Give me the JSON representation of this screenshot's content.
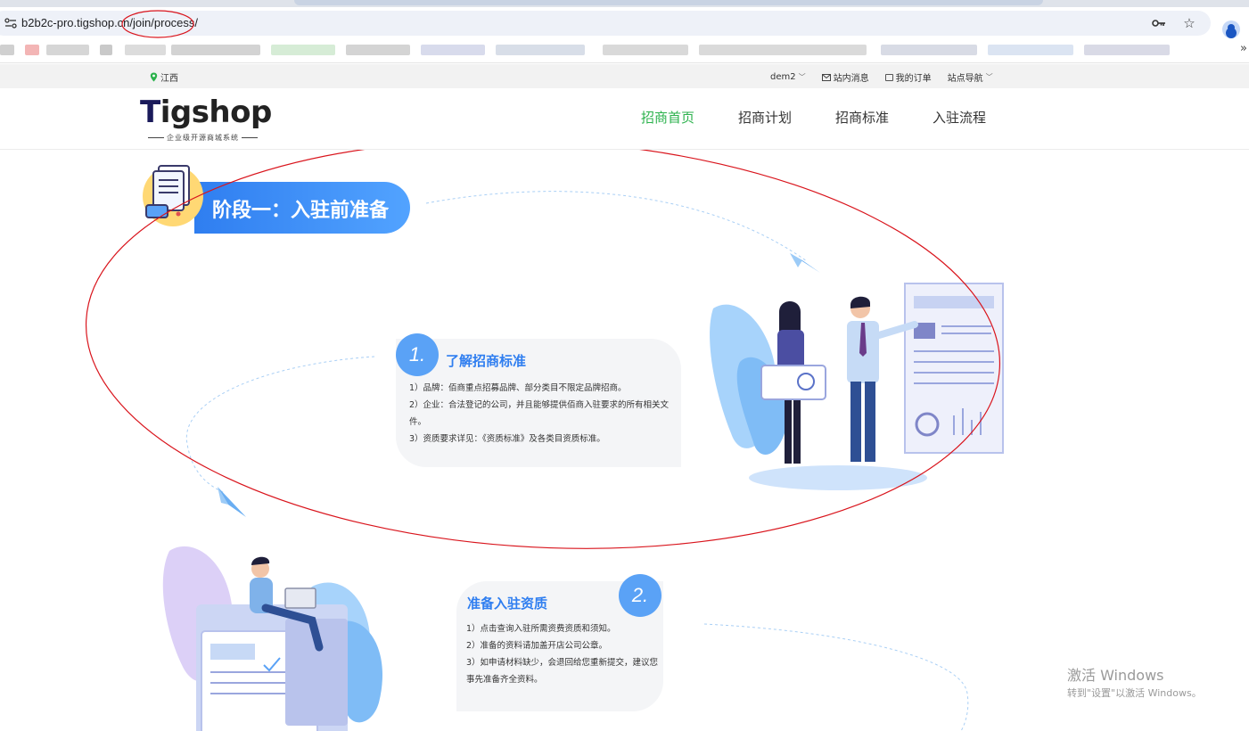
{
  "browser": {
    "url_host": "b2b2c-pro.tigshop.cn",
    "url_path": "/join/process/",
    "icons": [
      "site-info-icon",
      "key-icon",
      "star-icon",
      "profile-icon"
    ],
    "bookmarks_overflow": "»"
  },
  "topbar": {
    "location": "江西",
    "user": "dem2",
    "messages": "站内消息",
    "orders": "我的订单",
    "site_nav": "站点导航"
  },
  "header": {
    "logo_text_t": "T",
    "logo_text_rest": "igshop",
    "logo_subtitle": "企业级开源商城系统",
    "nav": [
      {
        "label": "招商首页",
        "active": true
      },
      {
        "label": "招商计划",
        "active": false
      },
      {
        "label": "招商标准",
        "active": false
      },
      {
        "label": "入驻流程",
        "active": false
      }
    ]
  },
  "stage": {
    "title": "阶段一：入驻前准备"
  },
  "steps": [
    {
      "number": "1.",
      "title": "了解招商标准",
      "lines": [
        "1）品牌：佰商重点招募品牌、部分类目不限定品牌招商。",
        "2）企业：合法登记的公司，并且能够提供佰商入驻要求的所有相关文件。",
        "3）资质要求详见：《资质标准》及各类目资质标准。"
      ]
    },
    {
      "number": "2.",
      "title": "准备入驻资质",
      "lines": [
        "1）点击查询入驻所需资费资质和须知。",
        "2）准备的资料请加盖开店公司公章。",
        "3）如申请材料缺少，会退回给您重新提交，建议您事先准备齐全资料。"
      ]
    }
  ],
  "watermark": {
    "line1": "激活 Windows",
    "line2": "转到\"设置\"以激活 Windows。"
  },
  "colors": {
    "nav_active": "#2bb24c",
    "accent_blue": "#2f7ef0",
    "annotation_red": "#d9141c"
  }
}
